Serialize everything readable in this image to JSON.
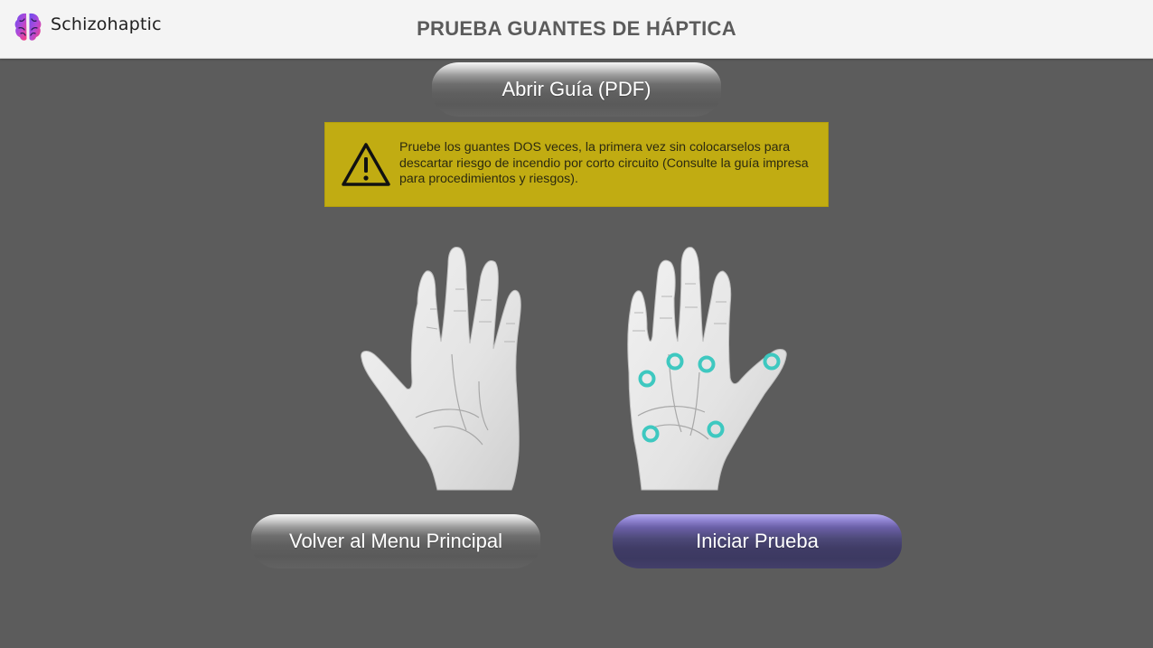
{
  "header": {
    "app_name": "Schizohaptic",
    "logo_icon": "brain-logo-icon",
    "title": "PRUEBA GUANTES DE HÁPTICA"
  },
  "guide_button": {
    "label": "Abrir Guía (PDF)"
  },
  "warning": {
    "icon": "warning-triangle-icon",
    "text": "Pruebe los guantes DOS veces, la primera vez sin colocarselos para descartar riesgo de incendio por corto circuito (Consulte la guía impresa para procedimientos y riesgos).",
    "background": "#c1ac12"
  },
  "hands": {
    "left_hand": "left-hand-palm-illustration",
    "right_hand": "right-hand-palm-with-haptic-points-illustration",
    "haptic_point_color": "#3ec8c0"
  },
  "buttons": {
    "back_label": "Volver al Menu Principal",
    "start_label": "Iniciar Prueba"
  },
  "colors": {
    "background": "#5c5c5c",
    "header": "#f4f4f4",
    "accent": "#4e4a7a"
  }
}
